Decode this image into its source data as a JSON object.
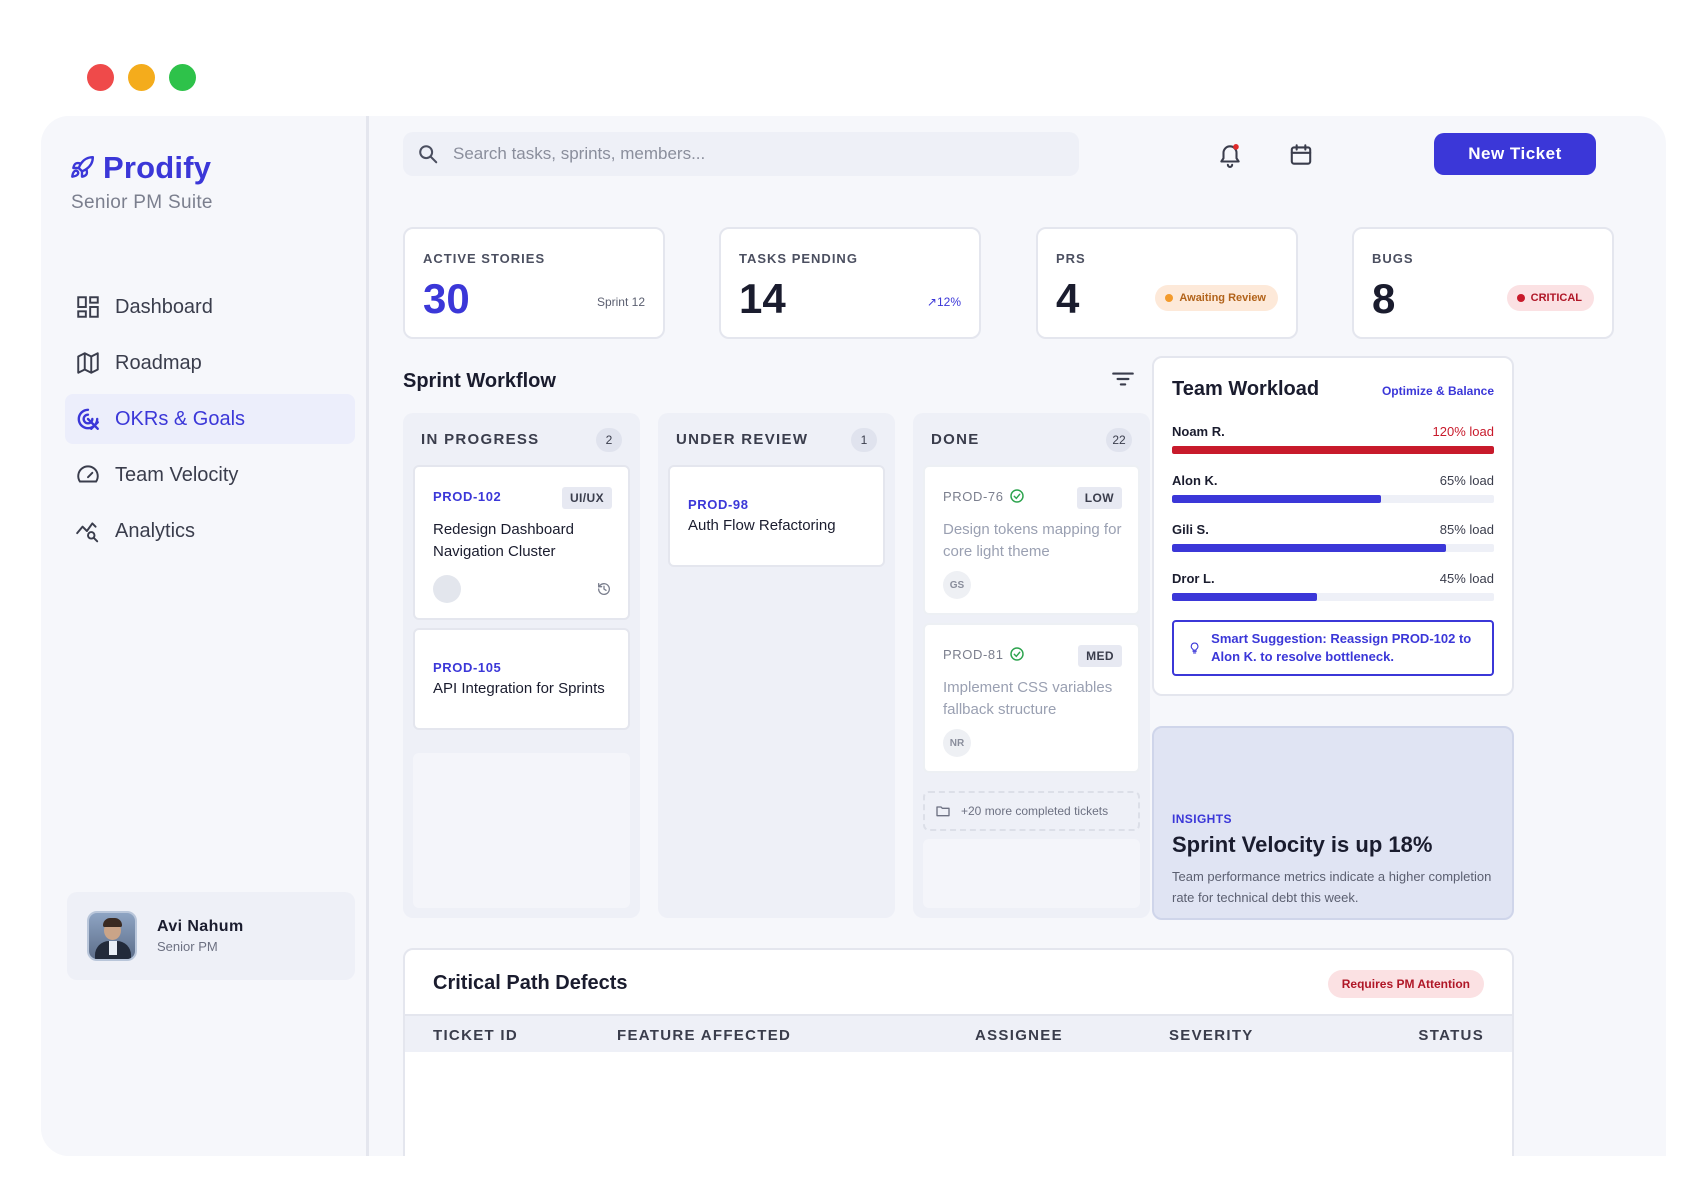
{
  "window_controls": {
    "close": "#ef4a4a",
    "minimize": "#f4ac1c",
    "maximize": "#2ec24a"
  },
  "colors": {
    "accent": "#3b37d8",
    "critical": "#c81a2b",
    "warning": "#f39a2b"
  },
  "brand": {
    "name": "Prodify",
    "subtitle": "Senior PM Suite",
    "icon": "rocket-icon"
  },
  "nav": {
    "items": [
      {
        "label": "Dashboard",
        "icon": "dashboard-icon",
        "active": false
      },
      {
        "label": "Roadmap",
        "icon": "map-icon",
        "active": false
      },
      {
        "label": "OKRs & Goals",
        "icon": "target-icon",
        "active": true
      },
      {
        "label": "Team Velocity",
        "icon": "speedometer-icon",
        "active": false
      },
      {
        "label": "Analytics",
        "icon": "analytics-icon",
        "active": false
      }
    ]
  },
  "profile": {
    "name": "Avi Nahum",
    "role": "Senior PM"
  },
  "header": {
    "search_placeholder": "Search tasks, sprints, members...",
    "new_ticket_label": "New Ticket"
  },
  "stats": {
    "active_stories": {
      "label": "ACTIVE STORIES",
      "value": "30",
      "meta": "Sprint 12"
    },
    "tasks_pending": {
      "label": "TASKS PENDING",
      "value": "14",
      "meta": "↗12%"
    },
    "prs": {
      "label": "PRS",
      "value": "4",
      "badge": "Awaiting Review"
    },
    "bugs": {
      "label": "BUGS",
      "value": "8",
      "badge": "CRITICAL"
    }
  },
  "workflow": {
    "title": "Sprint Workflow",
    "columns": [
      {
        "title": "IN PROGRESS",
        "count": "2",
        "cards": [
          {
            "id": "PROD-102",
            "title": "Redesign Dashboard Navigation Cluster",
            "tag": "UI/UX"
          },
          {
            "id": "PROD-105",
            "title": "API Integration for Sprints"
          }
        ]
      },
      {
        "title": "UNDER REVIEW",
        "count": "1",
        "cards": [
          {
            "id": "PROD-98",
            "title": "Auth Flow Refactoring"
          }
        ]
      },
      {
        "title": "DONE",
        "count": "22",
        "cards": [
          {
            "id": "PROD-76",
            "title": "Design tokens mapping for core light theme",
            "tag": "LOW",
            "assignee": "GS"
          },
          {
            "id": "PROD-81",
            "title": "Implement CSS variables fallback structure",
            "tag": "MED",
            "assignee": "NR"
          }
        ],
        "more": "+20 more completed tickets"
      }
    ]
  },
  "workload": {
    "title": "Team Workload",
    "action": "Optimize & Balance",
    "members": [
      {
        "name": "Noam R.",
        "load": "120% load",
        "fraction": 1.0,
        "over": true
      },
      {
        "name": "Alon K.",
        "load": "65% load",
        "fraction": 0.65,
        "over": false
      },
      {
        "name": "Gili S.",
        "load": "85% load",
        "fraction": 0.85,
        "over": false
      },
      {
        "name": "Dror L.",
        "load": "45% load",
        "fraction": 0.45,
        "over": false
      }
    ],
    "suggestion": "Smart Suggestion: Reassign PROD-102 to Alon K. to resolve bottleneck."
  },
  "insights": {
    "label": "INSIGHTS",
    "title": "Sprint Velocity is up 18%",
    "body": "Team performance metrics indicate a higher completion rate for technical debt this week."
  },
  "defects": {
    "title": "Critical Path Defects",
    "badge": "Requires PM Attention",
    "columns": [
      "TICKET ID",
      "FEATURE AFFECTED",
      "ASSIGNEE",
      "SEVERITY",
      "STATUS"
    ]
  }
}
